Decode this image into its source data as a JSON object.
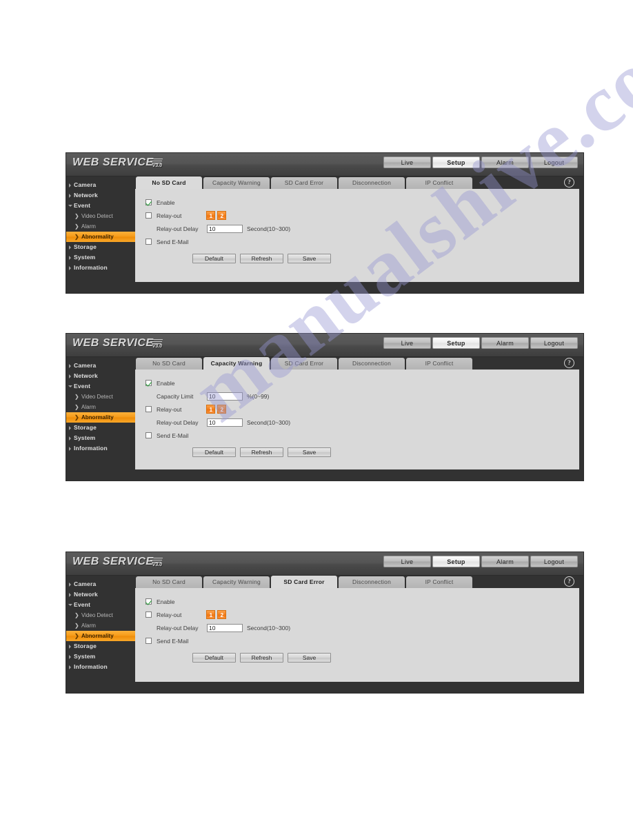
{
  "brand": {
    "word1": "WEB",
    "word2": "SERVICE",
    "version": "V3.0"
  },
  "topnav": [
    {
      "label": "Live",
      "active": false
    },
    {
      "label": "Setup",
      "active": true
    },
    {
      "label": "Alarm",
      "active": false
    },
    {
      "label": "Logout",
      "active": false
    }
  ],
  "sidebar": {
    "items": [
      {
        "label": "Camera",
        "type": "top",
        "open": false
      },
      {
        "label": "Network",
        "type": "top",
        "open": false
      },
      {
        "label": "Event",
        "type": "top",
        "open": true
      },
      {
        "label": "Video Detect",
        "type": "sub",
        "selected": false
      },
      {
        "label": "Alarm",
        "type": "sub",
        "selected": false
      },
      {
        "label": "Abnormality",
        "type": "sub",
        "selected": true
      },
      {
        "label": "Storage",
        "type": "top",
        "open": false
      },
      {
        "label": "System",
        "type": "top",
        "open": false
      },
      {
        "label": "Information",
        "type": "top",
        "open": false
      }
    ]
  },
  "tabs": [
    "No SD Card",
    "Capacity Warning",
    "SD Card Error",
    "Disconnection",
    "IP Conflict"
  ],
  "help_icon": "?",
  "form": {
    "enable_label": "Enable",
    "capacity_limit_label": "Capacity Limit",
    "capacity_limit_value": "10",
    "capacity_limit_unit": "%(0~99)",
    "relay_out_label": "Relay-out",
    "relay_buttons": [
      "1",
      "2"
    ],
    "relay_delay_label": "Relay-out Delay",
    "relay_delay_value": "10",
    "relay_delay_unit": "Second(10~300)",
    "send_email_label": "Send E-Mail"
  },
  "buttons": {
    "default": "Default",
    "refresh": "Refresh",
    "save": "Save"
  },
  "panels": [
    {
      "active_tab": "No SD Card",
      "active_index": 0,
      "has_capacity": false
    },
    {
      "active_tab": "Capacity Warning",
      "active_index": 1,
      "has_capacity": true
    },
    {
      "active_tab": "SD Card Error",
      "active_index": 2,
      "has_capacity": false
    }
  ],
  "watermark": {
    "text": "manualshive.com"
  },
  "colors": {
    "accent_orange": "#f58220",
    "window_dark": "#323232",
    "panel_gray": "#d9d9d9",
    "check_green": "#1d9a2f"
  }
}
